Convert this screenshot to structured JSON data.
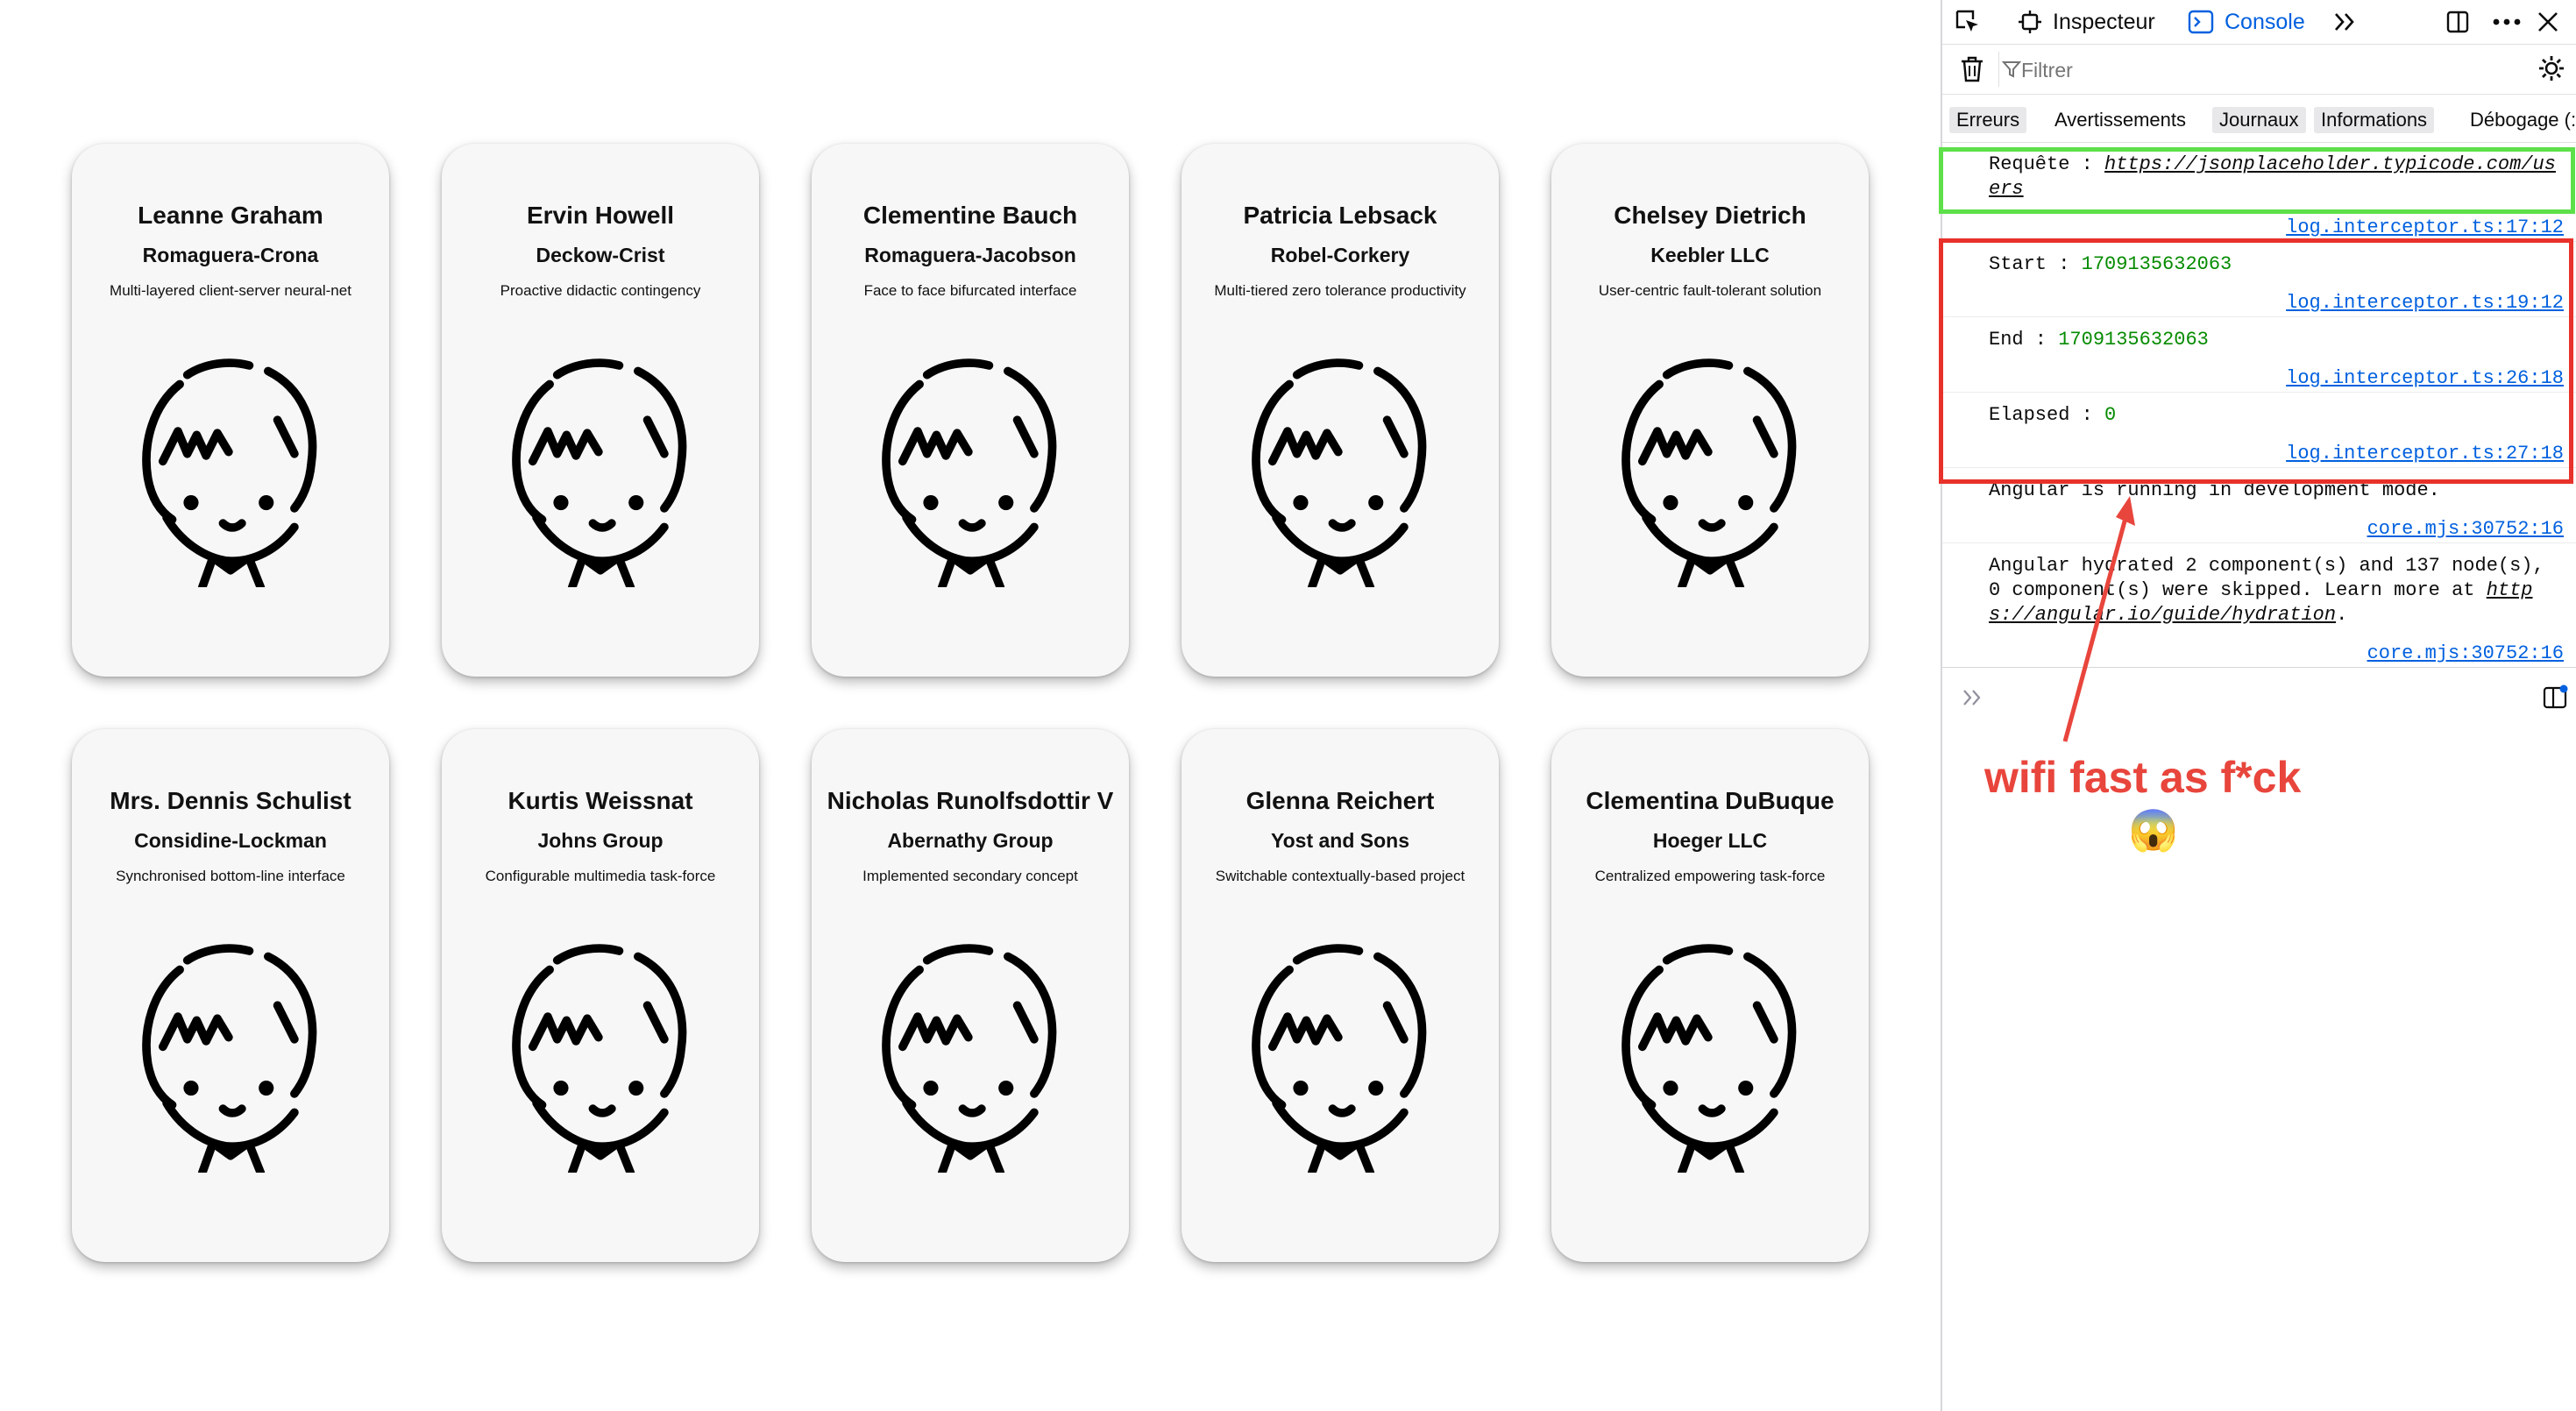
{
  "users": [
    {
      "name": "Leanne Graham",
      "company": "Romaguera-Crona",
      "phrase": "Multi-layered client-server neural-net"
    },
    {
      "name": "Ervin Howell",
      "company": "Deckow-Crist",
      "phrase": "Proactive didactic contingency"
    },
    {
      "name": "Clementine Bauch",
      "company": "Romaguera-Jacobson",
      "phrase": "Face to face bifurcated interface"
    },
    {
      "name": "Patricia Lebsack",
      "company": "Robel-Corkery",
      "phrase": "Multi-tiered zero tolerance productivity"
    },
    {
      "name": "Chelsey Dietrich",
      "company": "Keebler LLC",
      "phrase": "User-centric fault-tolerant solution"
    },
    {
      "name": "Mrs. Dennis Schulist",
      "company": "Considine-Lockman",
      "phrase": "Synchronised bottom-line interface"
    },
    {
      "name": "Kurtis Weissnat",
      "company": "Johns Group",
      "phrase": "Configurable multimedia task-force"
    },
    {
      "name": "Nicholas Runolfsdottir V",
      "company": "Abernathy Group",
      "phrase": "Implemented secondary concept"
    },
    {
      "name": "Glenna Reichert",
      "company": "Yost and Sons",
      "phrase": "Switchable contextually-based project"
    },
    {
      "name": "Clementina DuBuque",
      "company": "Hoeger LLC",
      "phrase": "Centralized empowering task-force"
    }
  ],
  "devtools": {
    "tabs": {
      "inspector": "Inspecteur",
      "console": "Console"
    },
    "filter_placeholder": "Filtrer",
    "categories": [
      "Erreurs",
      "Avertissements",
      "Journaux",
      "Informations",
      "Débogage (:"
    ],
    "messages": {
      "request_label": "Requête : ",
      "request_url_1": "https://jsonplaceholder.typicode.com/us",
      "request_url_2": "ers",
      "request_src": "log.interceptor.ts:17:12",
      "start_label": "Start : ",
      "start_value": "1709135632063",
      "start_src": "log.interceptor.ts:19:12",
      "end_label": "End : ",
      "end_value": "1709135632063",
      "end_src": "log.interceptor.ts:26:18",
      "elapsed_label": "Elapsed : ",
      "elapsed_value": "0",
      "elapsed_src": "log.interceptor.ts:27:18",
      "angular_dev": "Angular is running in development mode.",
      "angular_dev_src": "core.mjs:30752:16",
      "hydration_1": "Angular hydrated 2 component(s) and 137 node(s),",
      "hydration_2a": "0 component(s) were skipped. Learn more at ",
      "hydration_link_1": "http",
      "hydration_link_2": "s://angular.io/guide/hydration",
      "hydration_2b": ".",
      "hydration_src": "core.mjs:30752:16"
    },
    "prompt_symbol": "»"
  },
  "annotation": {
    "text": "wifi fast as f*ck",
    "emoji": "😱",
    "green_box_color": "#5ee04a",
    "red_box_color": "#e8312a"
  },
  "icons": [
    "pick-element-icon",
    "inspector-icon",
    "console-icon",
    "more-tabs-icon",
    "dock-icon",
    "menu-icon",
    "close-icon",
    "trash-icon",
    "filter-icon",
    "settings-icon",
    "prompt-chevron-icon",
    "sidebar-toggle-icon",
    "avatar-icon"
  ]
}
